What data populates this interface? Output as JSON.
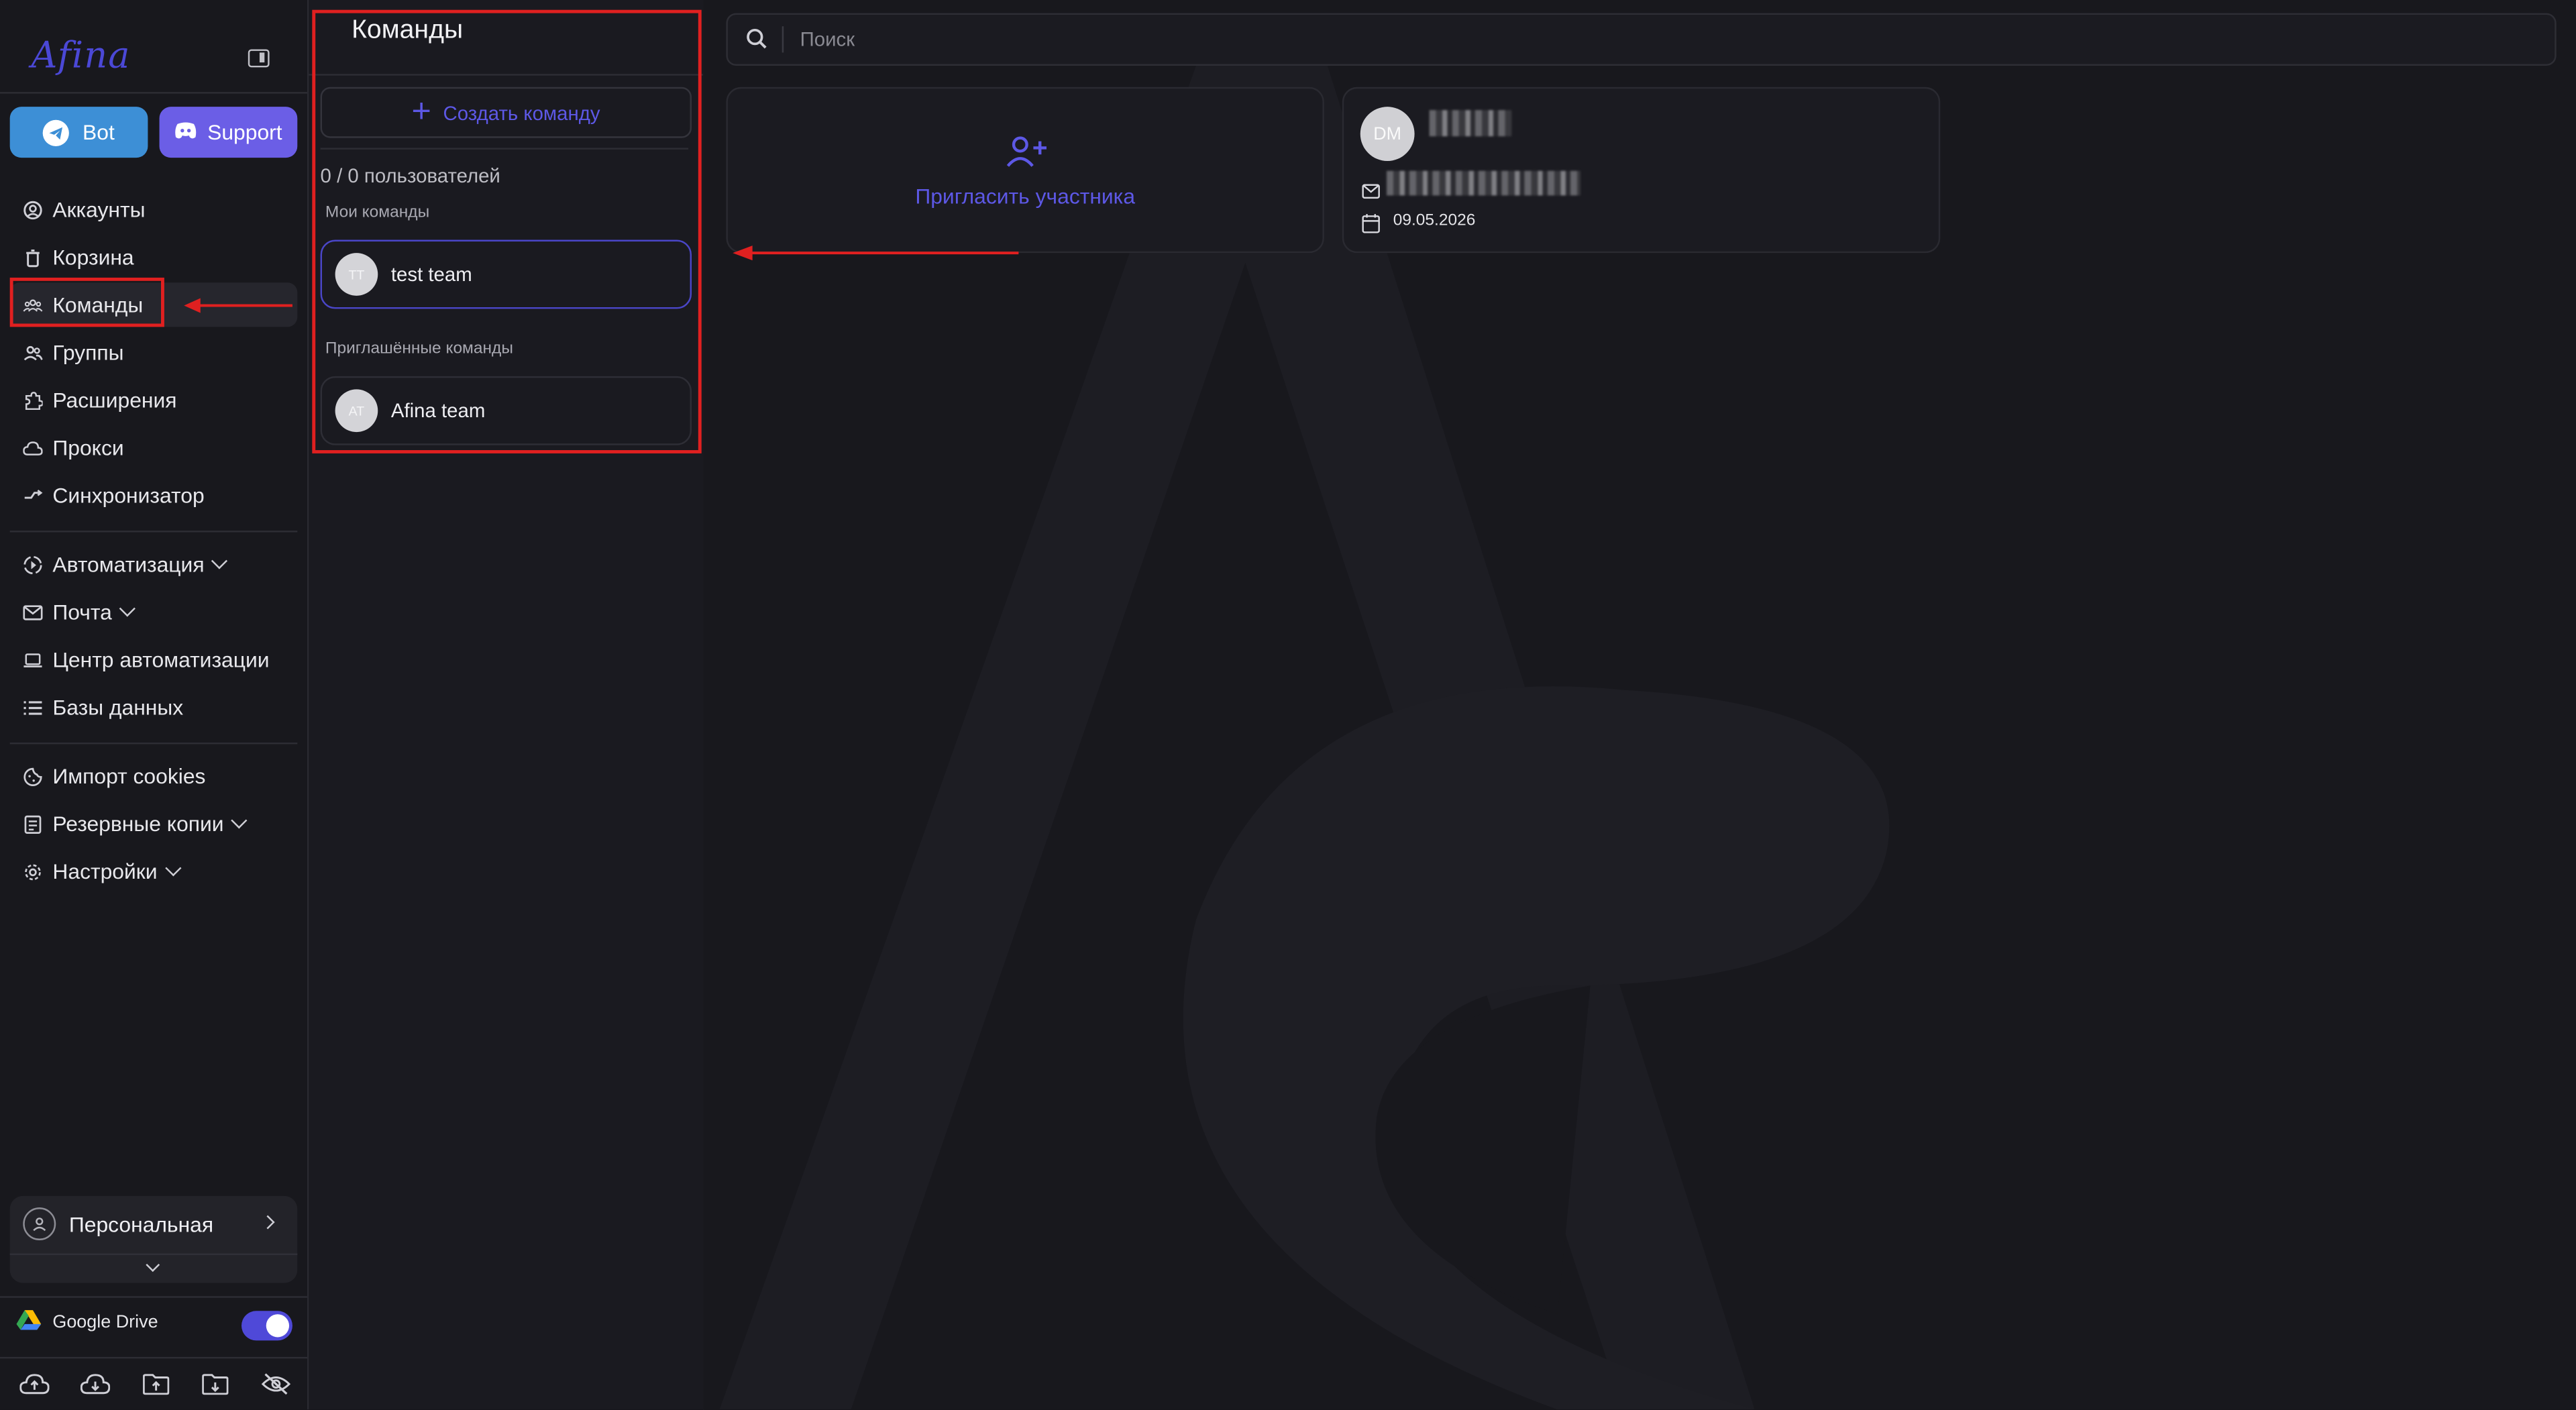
{
  "colors": {
    "accent": "#5d58e6",
    "bot_button": "#3d8fd6",
    "support_button": "#6b5ee6",
    "highlight": "#e02020"
  },
  "sidebar": {
    "logo": "Afina",
    "bot_label": "Bot",
    "support_label": "Support",
    "items": [
      {
        "label": "Аккаунты",
        "icon": "user-circle-icon"
      },
      {
        "label": "Корзина",
        "icon": "trash-icon"
      },
      {
        "label": "Команды",
        "icon": "team-icon"
      },
      {
        "label": "Группы",
        "icon": "group-icon"
      },
      {
        "label": "Расширения",
        "icon": "puzzle-icon"
      },
      {
        "label": "Прокси",
        "icon": "cloud-icon"
      },
      {
        "label": "Синхронизатор",
        "icon": "sync-icon"
      },
      {
        "label": "Автоматизация",
        "icon": "automation-icon"
      },
      {
        "label": "Почта",
        "icon": "mail-icon"
      },
      {
        "label": "Центр автоматизации",
        "icon": "laptop-icon"
      },
      {
        "label": "Базы данных",
        "icon": "list-icon"
      },
      {
        "label": "Импорт cookies",
        "icon": "cookie-icon"
      },
      {
        "label": "Резервные копии",
        "icon": "backup-icon"
      },
      {
        "label": "Настройки",
        "icon": "gear-icon"
      }
    ],
    "profile_label": "Персональная",
    "gdrive_label": "Google Drive",
    "gdrive_enabled": true
  },
  "teams": {
    "title": "Команды",
    "create_label": "Создать команду",
    "users_count": "0 / 0 пользователей",
    "my_teams_label": "Мои команды",
    "my_teams": [
      {
        "initials": "TT",
        "name": "test team"
      }
    ],
    "invited_label": "Приглашённые команды",
    "invited_teams": [
      {
        "initials": "AT",
        "name": "Afina team"
      }
    ]
  },
  "main": {
    "search_placeholder": "Поиск",
    "invite_label": "Пригласить участника",
    "member": {
      "initials": "DM",
      "date": "09.05.2026"
    }
  }
}
